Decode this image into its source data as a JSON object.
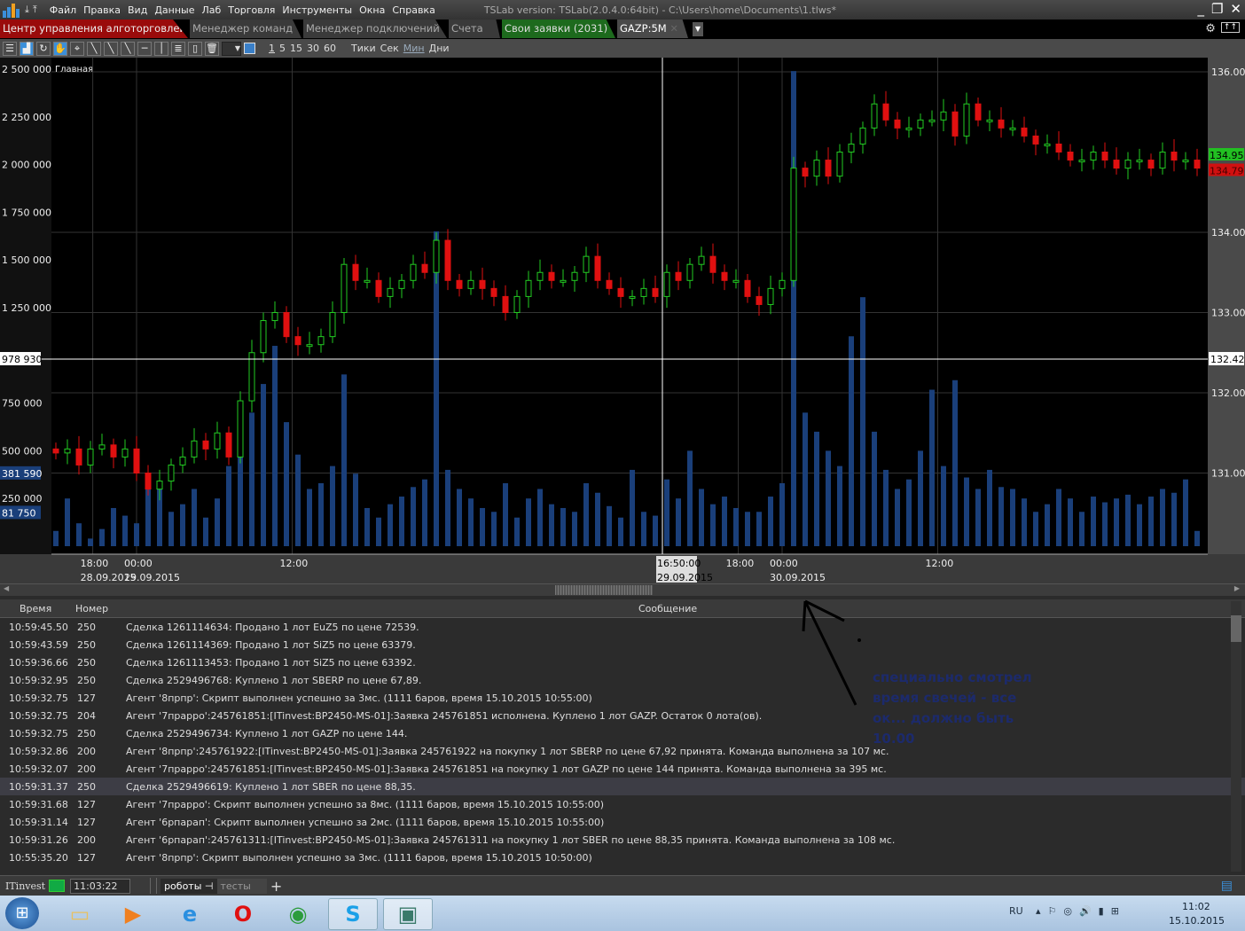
{
  "titlebar": {
    "menu": [
      "Файл",
      "Правка",
      "Вид",
      "Данные",
      "Лаб",
      "Торговля",
      "Инструменты",
      "Окна",
      "Справка"
    ],
    "title": "TSLab version:  TSLab(2.0.4.0:64bit) - C:\\Users\\home\\Documents\\1.tlws*"
  },
  "tabs": [
    "Центр управления алготорговлей",
    "Менеджер команд",
    "Менеджер подключений",
    "Счета",
    "Свои заявки (2031)",
    "GAZP:5M"
  ],
  "toolbar": {
    "intervals": [
      "1",
      "5",
      "15",
      "30",
      "60"
    ],
    "units": [
      "Тики",
      "Сек",
      "Мин",
      "Дни"
    ]
  },
  "chart_data": {
    "type": "candlestick+volume",
    "pane_title": "Главная",
    "price_ticks": [
      "136.00",
      "134.00",
      "133.00",
      "132.00",
      "131.00"
    ],
    "price_range": [
      130.1,
      136.15
    ],
    "volume_ticks": [
      "2 500 000",
      "2 250 000",
      "2 000 000",
      "1 750 000",
      "1 500 000",
      "1 250 000",
      "750 000",
      "500 000",
      "250 000"
    ],
    "volume_labels": {
      "cursor": "978 930",
      "vol1": "381 590",
      "vol2": "81 750"
    },
    "last_prices": {
      "bid": "134.95",
      "ask": "134.79",
      "cursor": "132.42"
    },
    "cursor": {
      "price": 132.42,
      "time": "16:50:00",
      "date": "29.09.2015",
      "index": 52
    },
    "time_labels": [
      {
        "t": "18:00",
        "d": "28.09.2015",
        "i": 3.2
      },
      {
        "t": "00:00",
        "d": "29.09.2015",
        "i": 7
      },
      {
        "t": "12:00",
        "d": "",
        "i": 20.5
      },
      {
        "t": "18:00",
        "d": "",
        "i": 59.2
      },
      {
        "t": "00:00",
        "d": "30.09.2015",
        "i": 63
      },
      {
        "t": "12:00",
        "d": "",
        "i": 76.5
      }
    ],
    "closes": [
      131.25,
      131.3,
      131.1,
      131.3,
      131.35,
      131.2,
      131.3,
      131.0,
      130.8,
      130.9,
      131.1,
      131.2,
      131.4,
      131.3,
      131.5,
      131.2,
      131.9,
      132.5,
      132.9,
      133.0,
      132.7,
      132.6,
      132.6,
      132.7,
      133.0,
      133.6,
      133.4,
      133.4,
      133.2,
      133.3,
      133.4,
      133.6,
      133.5,
      133.9,
      133.4,
      133.3,
      133.4,
      133.3,
      133.2,
      133.0,
      133.2,
      133.4,
      133.5,
      133.4,
      133.4,
      133.5,
      133.7,
      133.4,
      133.3,
      133.2,
      133.2,
      133.3,
      133.2,
      133.5,
      133.4,
      133.6,
      133.7,
      133.5,
      133.4,
      133.4,
      133.2,
      133.1,
      133.3,
      133.4,
      134.8,
      134.7,
      134.9,
      134.7,
      135.0,
      135.1,
      135.3,
      135.6,
      135.4,
      135.3,
      135.3,
      135.4,
      135.4,
      135.5,
      135.2,
      135.6,
      135.4,
      135.4,
      135.3,
      135.3,
      135.2,
      135.1,
      135.1,
      135.0,
      134.9,
      134.9,
      135.0,
      134.9,
      134.8,
      134.9,
      134.9,
      134.8,
      135.0,
      134.9,
      134.9,
      134.8
    ],
    "volumes": [
      80,
      250,
      120,
      40,
      90,
      200,
      160,
      120,
      380,
      300,
      180,
      220,
      300,
      150,
      250,
      420,
      520,
      700,
      850,
      1050,
      650,
      480,
      300,
      330,
      420,
      900,
      380,
      200,
      150,
      220,
      260,
      310,
      350,
      1650,
      400,
      300,
      250,
      200,
      180,
      330,
      150,
      250,
      300,
      220,
      200,
      180,
      330,
      280,
      210,
      150,
      400,
      180,
      160,
      350,
      250,
      500,
      300,
      220,
      260,
      200,
      180,
      180,
      260,
      330,
      2490,
      700,
      600,
      500,
      420,
      1100,
      1305,
      600,
      400,
      300,
      350,
      500,
      820,
      420,
      870,
      360,
      300,
      400,
      310,
      300,
      250,
      180,
      220,
      300,
      250,
      180,
      260,
      230,
      250,
      270,
      220,
      260,
      300,
      280,
      350,
      80
    ]
  },
  "log": {
    "headers": [
      "Время",
      "Номер",
      "Сообщение"
    ],
    "rows": [
      [
        "10:59:45.50",
        "250",
        "Сделка 1261114634: Продано 1 лот EuZ5 по цене 72539."
      ],
      [
        "10:59:43.59",
        "250",
        "Сделка 1261114369: Продано 1 лот SiZ5 по цене 63379."
      ],
      [
        "10:59:36.66",
        "250",
        "Сделка 1261113453: Продано 1 лот SiZ5 по цене 63392."
      ],
      [
        "10:59:32.95",
        "250",
        "Сделка 2529496768: Куплено 1 лот SBERP по цене 67,89."
      ],
      [
        "10:59:32.75",
        "127",
        "Агент '8прпр': Скрипт выполнен успешно за 3мс. (1111 баров, время 15.10.2015 10:55:00)"
      ],
      [
        "10:59:32.75",
        "204",
        "Агент '7прарро':245761851:[ITinvest:BP2450-MS-01]:Заявка 245761851 исполнена. Куплено 1 лот GAZP. Остаток 0 лота(ов)."
      ],
      [
        "10:59:32.75",
        "250",
        "Сделка 2529496734: Куплено 1 лот GAZP по цене 144."
      ],
      [
        "10:59:32.86",
        "200",
        "Агент '8прпр':245761922:[ITinvest:BP2450-MS-01]:Заявка 245761922 на покупку 1 лот SBERP по цене 67,92 принята. Команда выполнена за 107 мс."
      ],
      [
        "10:59:32.07",
        "200",
        "Агент '7прарро':245761851:[ITinvest:BP2450-MS-01]:Заявка 245761851 на покупку 1 лот GAZP по цене 144 принята. Команда выполнена за 395 мс."
      ],
      [
        "10:59:31.37",
        "250",
        "Сделка 2529496619: Куплено 1 лот SBER по цене 88,35."
      ],
      [
        "10:59:31.68",
        "127",
        "Агент '7прарро': Скрипт выполнен успешно за 8мс. (1111 баров, время 15.10.2015 10:55:00)"
      ],
      [
        "10:59:31.14",
        "127",
        "Агент '6рпарап': Скрипт выполнен успешно за 2мс. (1111 баров, время 15.10.2015 10:55:00)"
      ],
      [
        "10:59:31.26",
        "200",
        "Агент '6рпарап':245761311:[ITinvest:BP2450-MS-01]:Заявка 245761311 на покупку 1 лот SBER по цене 88,35 принята. Команда выполнена за 108 мс."
      ],
      [
        "10:55:35.20",
        "127",
        "Агент '8прпр': Скрипт выполнен успешно за 3мс. (1111 баров, время 15.10.2015 10:50:00)"
      ]
    ],
    "highlight": 9
  },
  "annotation": "специально смотрел время свечей - все ок... должно быть 10.00",
  "status": {
    "broker": "ITinvest",
    "time": "11:03:22",
    "tabs": [
      "роботы",
      "тесты"
    ]
  },
  "taskbar": {
    "lang": "RU",
    "clock": "11:02",
    "date": "15.10.2015"
  },
  "colors": {
    "up": "#22cc22",
    "down": "#e01010",
    "volume": "#1a3f7a",
    "grid": "#333333"
  }
}
